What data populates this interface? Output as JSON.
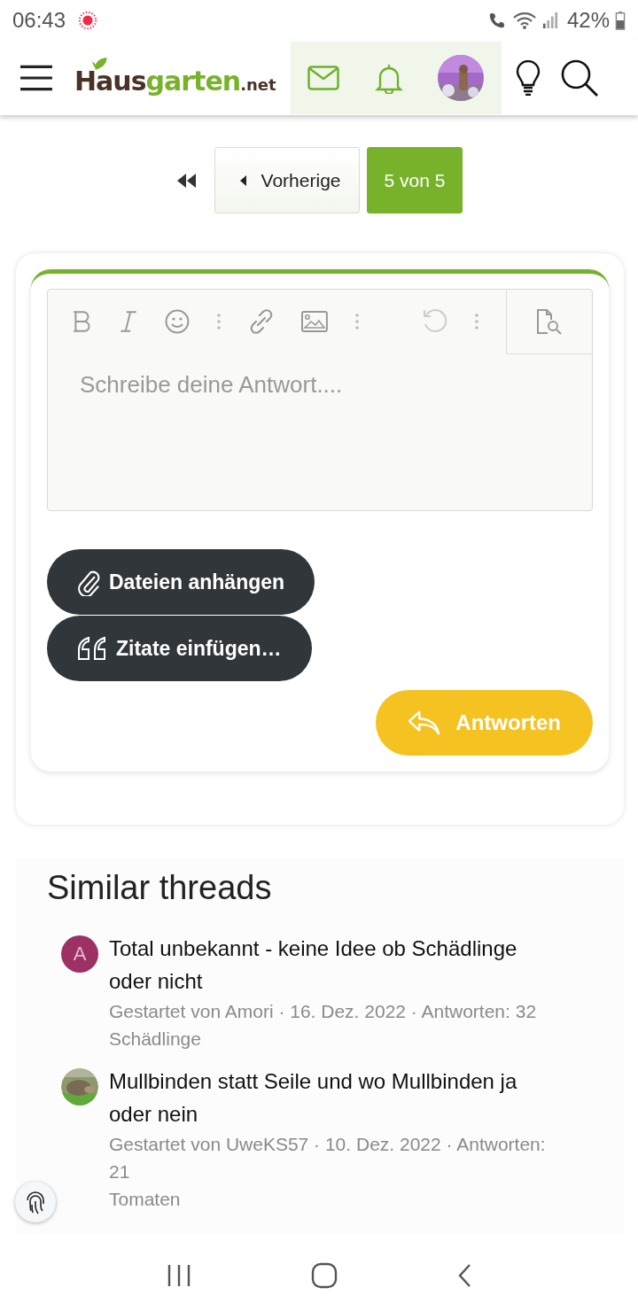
{
  "status_bar": {
    "time": "06:43",
    "battery": "42%"
  },
  "header": {
    "logo": {
      "part_1": "Haus",
      "part_2": "garten",
      "part_3": ".net"
    }
  },
  "pagination": {
    "previous": "Vorherige",
    "pages": [
      {
        "label": "5 von 5",
        "selected": true
      }
    ]
  },
  "editor": {
    "placeholder": "Schreibe deine Antwort...."
  },
  "actions": [
    {
      "kind": "attach",
      "label": "Dateien anhängen"
    },
    {
      "kind": "quote",
      "label": "Zitate einfügen…"
    }
  ],
  "submit": {
    "label": "Antworten"
  },
  "similar_threads": {
    "title": "Similar threads",
    "items": [
      {
        "avatar": {
          "kind": "letter",
          "letter": "A",
          "color": "#9c3166"
        },
        "title": "Total unbekannt - keine Idee ob Schädlinge oder nicht",
        "meta": "Gestartet von Amori · 16. Dez. 2022 · Antworten: 32",
        "forum": "Schädlinge"
      },
      {
        "title": "Mullbinden statt Seile und wo Mullbinden ja oder nein",
        "meta": "Gestartet von UweKS57 · 10. Dez. 2022 · Antworten: 21",
        "forum": "Tomaten"
      }
    ]
  }
}
